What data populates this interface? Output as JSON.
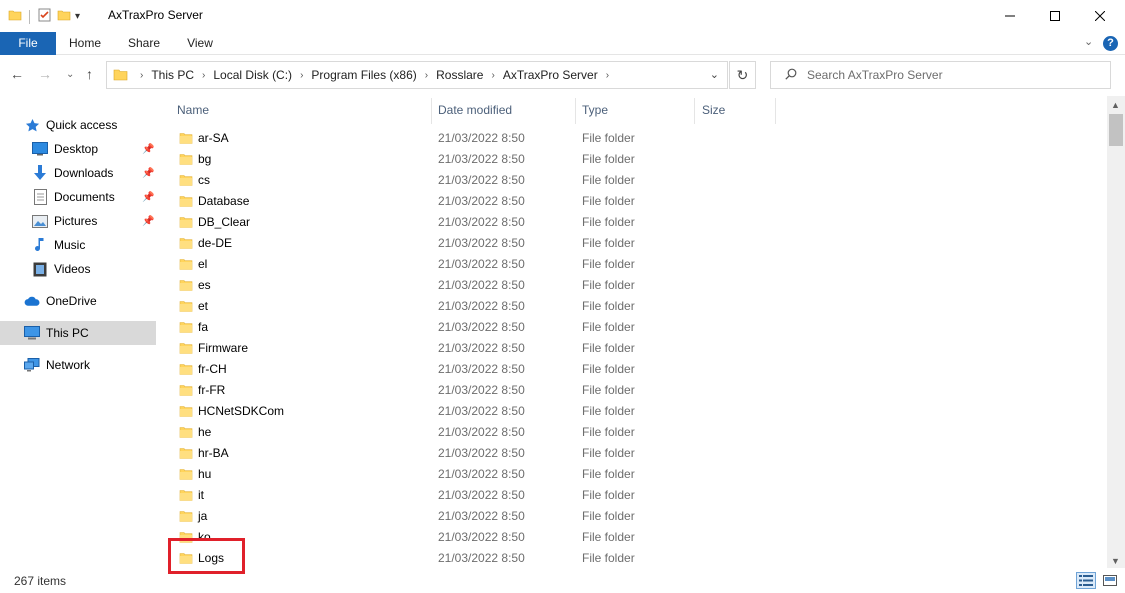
{
  "window": {
    "title": "AxTraxPro Server"
  },
  "ribbon": {
    "tabs": [
      "File",
      "Home",
      "Share",
      "View"
    ]
  },
  "address": {
    "crumbs": [
      "This PC",
      "Local Disk (C:)",
      "Program Files (x86)",
      "Rosslare",
      "AxTraxPro Server"
    ]
  },
  "search": {
    "placeholder": "Search AxTraxPro Server"
  },
  "sidebar": {
    "items": [
      {
        "label": "Quick access",
        "icon": "star-icon"
      },
      {
        "label": "Desktop",
        "icon": "desktop-icon",
        "pinned": true
      },
      {
        "label": "Downloads",
        "icon": "download-icon",
        "pinned": true
      },
      {
        "label": "Documents",
        "icon": "documents-icon",
        "pinned": true
      },
      {
        "label": "Pictures",
        "icon": "pictures-icon",
        "pinned": true
      },
      {
        "label": "Music",
        "icon": "music-icon"
      },
      {
        "label": "Videos",
        "icon": "videos-icon"
      },
      {
        "label": "OneDrive",
        "icon": "cloud-icon"
      },
      {
        "label": "This PC",
        "icon": "computer-icon",
        "selected": true
      },
      {
        "label": "Network",
        "icon": "network-icon"
      }
    ]
  },
  "columns": [
    "Name",
    "Date modified",
    "Type",
    "Size"
  ],
  "files": [
    {
      "name": "ar-SA",
      "date": "21/03/2022 8:50",
      "type": "File folder"
    },
    {
      "name": "bg",
      "date": "21/03/2022 8:50",
      "type": "File folder"
    },
    {
      "name": "cs",
      "date": "21/03/2022 8:50",
      "type": "File folder"
    },
    {
      "name": "Database",
      "date": "21/03/2022 8:50",
      "type": "File folder"
    },
    {
      "name": "DB_Clear",
      "date": "21/03/2022 8:50",
      "type": "File folder"
    },
    {
      "name": "de-DE",
      "date": "21/03/2022 8:50",
      "type": "File folder"
    },
    {
      "name": "el",
      "date": "21/03/2022 8:50",
      "type": "File folder"
    },
    {
      "name": "es",
      "date": "21/03/2022 8:50",
      "type": "File folder"
    },
    {
      "name": "et",
      "date": "21/03/2022 8:50",
      "type": "File folder"
    },
    {
      "name": "fa",
      "date": "21/03/2022 8:50",
      "type": "File folder"
    },
    {
      "name": "Firmware",
      "date": "21/03/2022 8:50",
      "type": "File folder"
    },
    {
      "name": "fr-CH",
      "date": "21/03/2022 8:50",
      "type": "File folder"
    },
    {
      "name": "fr-FR",
      "date": "21/03/2022 8:50",
      "type": "File folder"
    },
    {
      "name": "HCNetSDKCom",
      "date": "21/03/2022 8:50",
      "type": "File folder"
    },
    {
      "name": "he",
      "date": "21/03/2022 8:50",
      "type": "File folder"
    },
    {
      "name": "hr-BA",
      "date": "21/03/2022 8:50",
      "type": "File folder"
    },
    {
      "name": "hu",
      "date": "21/03/2022 8:50",
      "type": "File folder"
    },
    {
      "name": "it",
      "date": "21/03/2022 8:50",
      "type": "File folder"
    },
    {
      "name": "ja",
      "date": "21/03/2022 8:50",
      "type": "File folder"
    },
    {
      "name": "ko",
      "date": "21/03/2022 8:50",
      "type": "File folder"
    },
    {
      "name": "Logs",
      "date": "21/03/2022 8:50",
      "type": "File folder",
      "highlighted": true
    }
  ],
  "status": {
    "count": "267 items"
  },
  "colors": {
    "accent": "#1a65b4",
    "folder": "#ffd45c",
    "highlight": "#e0202a",
    "selected_nav": "#d9d9d9"
  }
}
